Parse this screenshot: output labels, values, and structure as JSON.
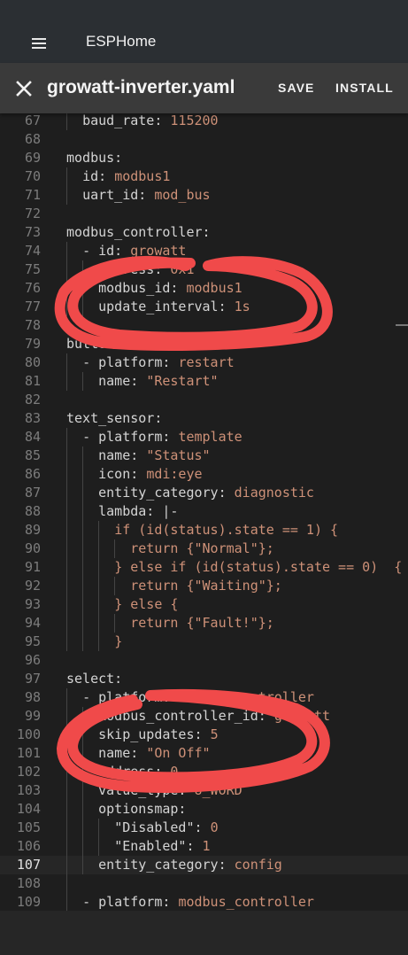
{
  "app": {
    "title": "ESPHome"
  },
  "editor": {
    "file_name": "growatt-inverter.yaml",
    "save_label": "SAVE",
    "install_label": "INSTALL",
    "active_line": 107,
    "lines": [
      {
        "n": "67",
        "code": "  baud_rate: 115200"
      },
      {
        "n": "68",
        "code": ""
      },
      {
        "n": "69",
        "code": "modbus:"
      },
      {
        "n": "70",
        "code": "  id: modbus1"
      },
      {
        "n": "71",
        "code": "  uart_id: mod_bus"
      },
      {
        "n": "72",
        "code": ""
      },
      {
        "n": "73",
        "code": "modbus_controller:"
      },
      {
        "n": "74",
        "code": "  - id: growatt"
      },
      {
        "n": "75",
        "code": "    address: 0x1"
      },
      {
        "n": "76",
        "code": "    modbus_id: modbus1"
      },
      {
        "n": "77",
        "code": "    update_interval: 1s"
      },
      {
        "n": "78",
        "code": ""
      },
      {
        "n": "79",
        "code": "button:"
      },
      {
        "n": "80",
        "code": "  - platform: restart"
      },
      {
        "n": "81",
        "code": "    name: \"Restart\""
      },
      {
        "n": "82",
        "code": ""
      },
      {
        "n": "83",
        "code": "text_sensor:"
      },
      {
        "n": "84",
        "code": "  - platform: template"
      },
      {
        "n": "85",
        "code": "    name: \"Status\""
      },
      {
        "n": "86",
        "code": "    icon: mdi:eye"
      },
      {
        "n": "87",
        "code": "    entity_category: diagnostic"
      },
      {
        "n": "88",
        "code": "    lambda: |-"
      },
      {
        "n": "89",
        "code": "      if (id(status).state == 1) {"
      },
      {
        "n": "90",
        "code": "        return {\"Normal\"};"
      },
      {
        "n": "91",
        "code": "      } else if (id(status).state == 0)  {"
      },
      {
        "n": "92",
        "code": "        return {\"Waiting\"};"
      },
      {
        "n": "93",
        "code": "      } else {"
      },
      {
        "n": "94",
        "code": "        return {\"Fault!\"};"
      },
      {
        "n": "95",
        "code": "      }"
      },
      {
        "n": "96",
        "code": ""
      },
      {
        "n": "97",
        "code": "select:"
      },
      {
        "n": "98",
        "code": "  - platform: modbus_controller"
      },
      {
        "n": "99",
        "code": "    modbus_controller_id: growatt"
      },
      {
        "n": "100",
        "code": "    skip_updates: 5"
      },
      {
        "n": "101",
        "code": "    name: \"On Off\""
      },
      {
        "n": "102",
        "code": "    address: 0"
      },
      {
        "n": "103",
        "code": "    value_type: U_WORD"
      },
      {
        "n": "104",
        "code": "    optionsmap:"
      },
      {
        "n": "105",
        "code": "      \"Disabled\": 0"
      },
      {
        "n": "106",
        "code": "      \"Enabled\": 1"
      },
      {
        "n": "107",
        "code": "    entity_category: config"
      },
      {
        "n": "108",
        "code": ""
      },
      {
        "n": "109",
        "code": "  - platform: modbus_controller"
      }
    ]
  },
  "colors": {
    "header_bg": "#2b2f33",
    "toolbar_bg": "#3a3a3a",
    "editor_bg": "#1e1e1e",
    "key_text": "#d4d4d4",
    "value_text": "#ce9178",
    "line_number": "#7c7c7c",
    "annotation_red": "#f04a4a"
  },
  "icons": {
    "menu": "hamburger-icon",
    "close": "close-icon"
  }
}
